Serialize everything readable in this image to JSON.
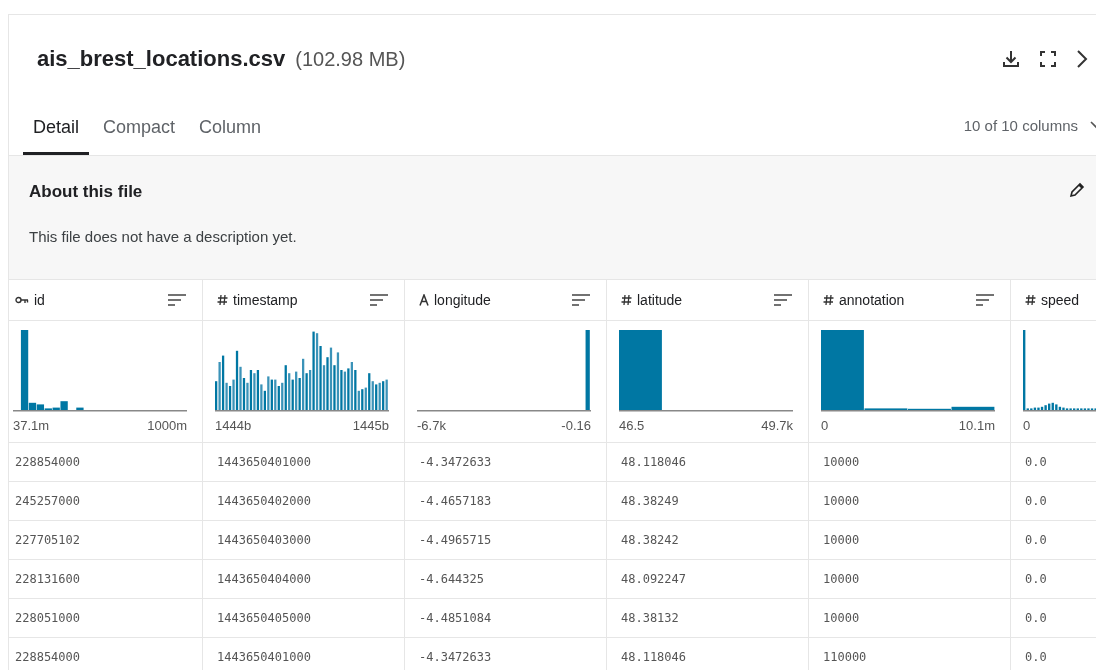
{
  "file": {
    "name": "ais_brest_locations.csv",
    "size": "(102.98 MB)"
  },
  "tabs": [
    {
      "label": "Detail",
      "selected": true
    },
    {
      "label": "Compact",
      "selected": false
    },
    {
      "label": "Column",
      "selected": false
    }
  ],
  "column_count": "10 of 10 columns",
  "about": {
    "title": "About this file",
    "description": "This file does not have a description yet."
  },
  "columns": [
    {
      "name": "id",
      "kind": "key",
      "min": "37.1m",
      "max": "1000m"
    },
    {
      "name": "timestamp",
      "kind": "number",
      "min": "1444b",
      "max": "1445b"
    },
    {
      "name": "longitude",
      "kind": "string",
      "min": "-6.7k",
      "max": "-0.16"
    },
    {
      "name": "latitude",
      "kind": "number",
      "min": "46.5",
      "max": "49.7k"
    },
    {
      "name": "annotation",
      "kind": "number",
      "min": "0",
      "max": "10.1m"
    },
    {
      "name": "speed",
      "kind": "number",
      "min": "0"
    }
  ],
  "rows": [
    [
      "228854000",
      "1443650401000",
      "-4.3472633",
      "48.118046",
      "10000",
      "0.0"
    ],
    [
      "245257000",
      "1443650402000",
      "-4.4657183",
      "48.38249",
      "10000",
      "0.0"
    ],
    [
      "227705102",
      "1443650403000",
      "-4.4965715",
      "48.38242",
      "10000",
      "0.0"
    ],
    [
      "228131600",
      "1443650404000",
      "-4.644325",
      "48.092247",
      "10000",
      "0.0"
    ],
    [
      "228051000",
      "1443650405000",
      "-4.4851084",
      "48.38132",
      "10000",
      "0.0"
    ],
    [
      "228854000",
      "1443650401000",
      "-4.3472633",
      "48.118046",
      "110000",
      "0.0"
    ]
  ]
}
